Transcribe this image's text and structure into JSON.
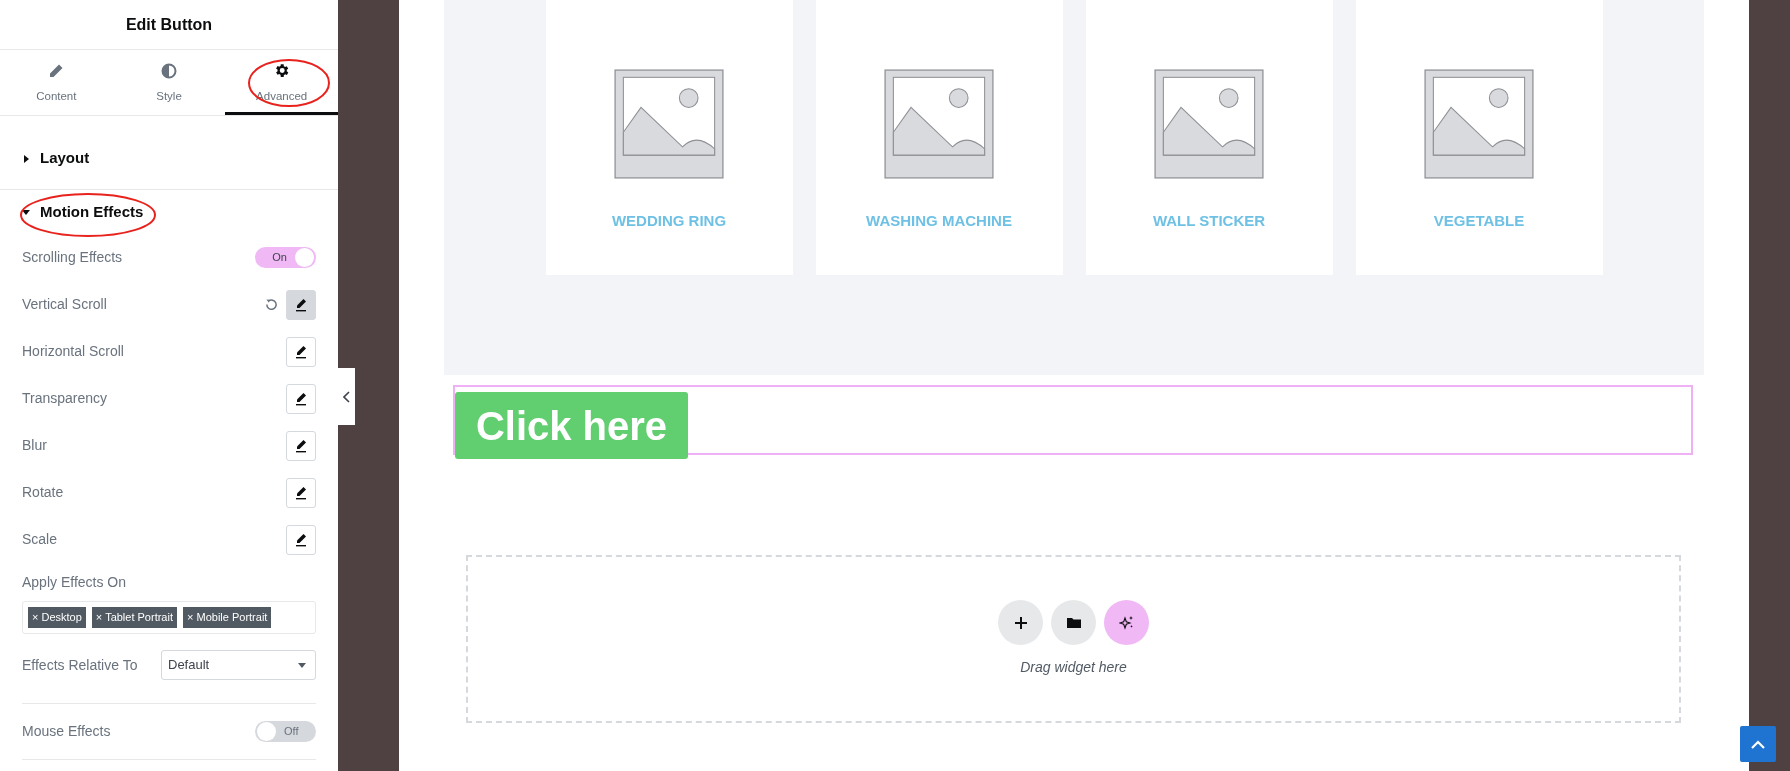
{
  "panel": {
    "title": "Edit Button",
    "tabs": [
      {
        "label": "Content",
        "kind": "pencil",
        "selected": false,
        "highlighted": false
      },
      {
        "label": "Style",
        "kind": "contrast",
        "selected": false,
        "highlighted": false
      },
      {
        "label": "Advanced",
        "kind": "gear",
        "selected": true,
        "highlighted": true
      }
    ],
    "sections": [
      {
        "title": "Layout",
        "expanded": false,
        "highlighted": false
      },
      {
        "title": "Motion Effects",
        "expanded": true,
        "highlighted": true,
        "controls": [
          {
            "kind": "switch",
            "label": "Scrolling Effects",
            "on": true,
            "state_label": "On"
          },
          {
            "kind": "popover",
            "label": "Vertical Scroll",
            "reset": true,
            "active": true
          },
          {
            "kind": "popover",
            "label": "Horizontal Scroll",
            "reset": false,
            "active": false
          },
          {
            "kind": "popover",
            "label": "Transparency",
            "reset": false,
            "active": false
          },
          {
            "kind": "popover",
            "label": "Blur",
            "reset": false,
            "active": false
          },
          {
            "kind": "popover",
            "label": "Rotate",
            "reset": false,
            "active": false
          },
          {
            "kind": "popover",
            "label": "Scale",
            "reset": false,
            "active": false
          },
          {
            "kind": "tags",
            "label": "Apply Effects On",
            "tags": [
              "× Desktop",
              "× Tablet Portrait",
              "× Mobile Portrait"
            ]
          },
          {
            "kind": "select",
            "label": "Effects Relative To",
            "value": "Default"
          },
          {
            "kind": "switch",
            "label": "Mouse Effects",
            "on": false,
            "state_label": "Off",
            "separated": true
          }
        ]
      }
    ]
  },
  "canvas": {
    "products": [
      {
        "name": "WEDDING RING"
      },
      {
        "name": "WASHING MACHINE"
      },
      {
        "name": "WALL STICKER"
      },
      {
        "name": "VEGETABLE"
      }
    ],
    "button": {
      "label": "Click here"
    },
    "drop_zone": {
      "label": "Drag widget here"
    }
  }
}
